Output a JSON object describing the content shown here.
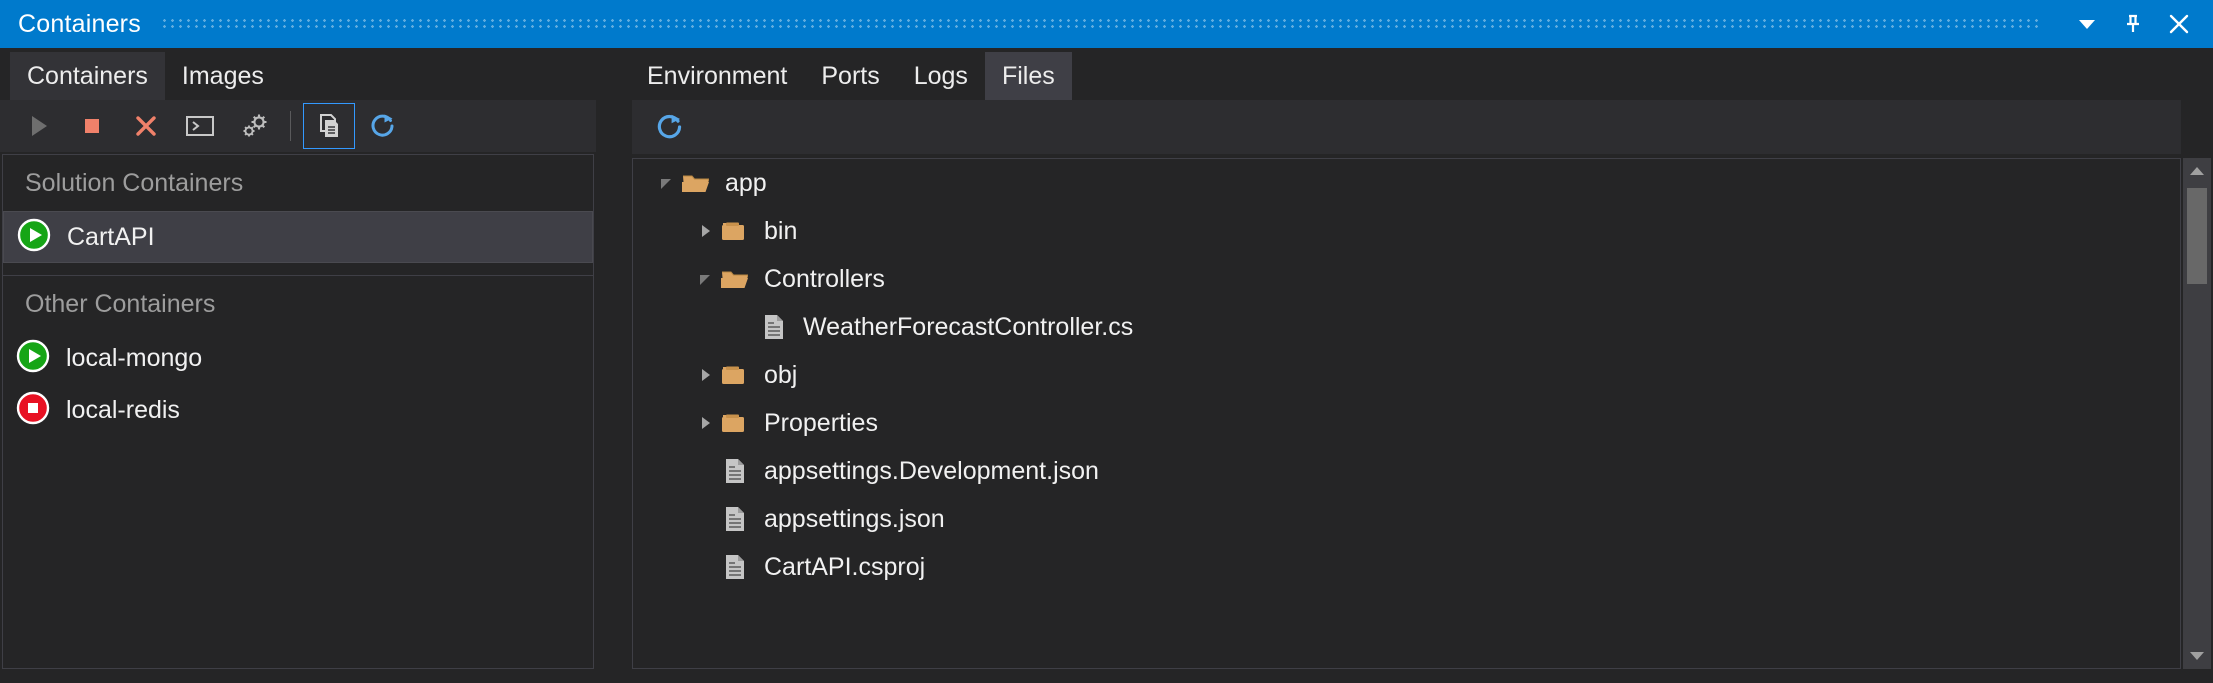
{
  "window": {
    "title": "Containers",
    "buttons": [
      {
        "name": "chevron-down-icon",
        "label": "Window options"
      },
      {
        "name": "pin-icon",
        "label": "Auto Hide"
      },
      {
        "name": "close-icon",
        "label": "Close"
      }
    ]
  },
  "left_panel": {
    "tabs": [
      {
        "label": "Containers",
        "selected": true
      },
      {
        "label": "Images",
        "selected": false
      }
    ],
    "toolbar": [
      {
        "name": "play-icon",
        "label": "Start",
        "state": "disabled"
      },
      {
        "name": "stop-icon",
        "label": "Stop",
        "state": "enabled"
      },
      {
        "name": "remove-icon",
        "label": "Remove",
        "state": "enabled"
      },
      {
        "name": "terminal-icon",
        "label": "Open Terminal",
        "state": "enabled"
      },
      {
        "name": "settings-gears-icon",
        "label": "Settings",
        "state": "enabled"
      },
      {
        "name": "files-copy-icon",
        "label": "Files",
        "state": "selected"
      },
      {
        "name": "refresh-icon",
        "label": "Refresh",
        "state": "enabled"
      }
    ],
    "groups": [
      {
        "title": "Solution Containers",
        "items": [
          {
            "name": "CartAPI",
            "status": "running",
            "selected": true
          }
        ]
      },
      {
        "title": "Other Containers",
        "items": [
          {
            "name": "local-mongo",
            "status": "running",
            "selected": false
          },
          {
            "name": "local-redis",
            "status": "stopped",
            "selected": false
          }
        ]
      }
    ]
  },
  "right_panel": {
    "tabs": [
      {
        "label": "Environment",
        "selected": false
      },
      {
        "label": "Ports",
        "selected": false
      },
      {
        "label": "Logs",
        "selected": false
      },
      {
        "label": "Files",
        "selected": true
      }
    ],
    "toolbar": [
      {
        "name": "refresh-icon",
        "label": "Refresh"
      }
    ],
    "tree": [
      {
        "label": "app",
        "type": "folder",
        "expanded": true,
        "depth": 0
      },
      {
        "label": "bin",
        "type": "folder",
        "expanded": false,
        "depth": 1
      },
      {
        "label": "Controllers",
        "type": "folder",
        "expanded": true,
        "depth": 1
      },
      {
        "label": "WeatherForecastController.cs",
        "type": "file",
        "depth": 2
      },
      {
        "label": "obj",
        "type": "folder",
        "expanded": false,
        "depth": 1
      },
      {
        "label": "Properties",
        "type": "folder",
        "expanded": false,
        "depth": 1
      },
      {
        "label": "appsettings.Development.json",
        "type": "file",
        "depth": 1
      },
      {
        "label": "appsettings.json",
        "type": "file",
        "depth": 1
      },
      {
        "label": "CartAPI.csproj",
        "type": "file",
        "depth": 1
      }
    ],
    "scrollbar": {
      "up": "scroll-up-arrow",
      "down": "scroll-down-arrow",
      "thumb": "scroll-thumb"
    }
  },
  "colors": {
    "title_bar": "#007ACC",
    "accent_blue": "#3399FF",
    "refresh_blue": "#57A6E8",
    "panel_bg": "#252526",
    "toolbar_bg": "#2D2D30",
    "selection_bg": "#3F3F46",
    "folder": "#DCA562",
    "file": "#C5C5C5",
    "running": "#16A516",
    "stopped": "#E81123",
    "stop_button": "#F0816A",
    "group_header_text": "#9D9D9D"
  }
}
